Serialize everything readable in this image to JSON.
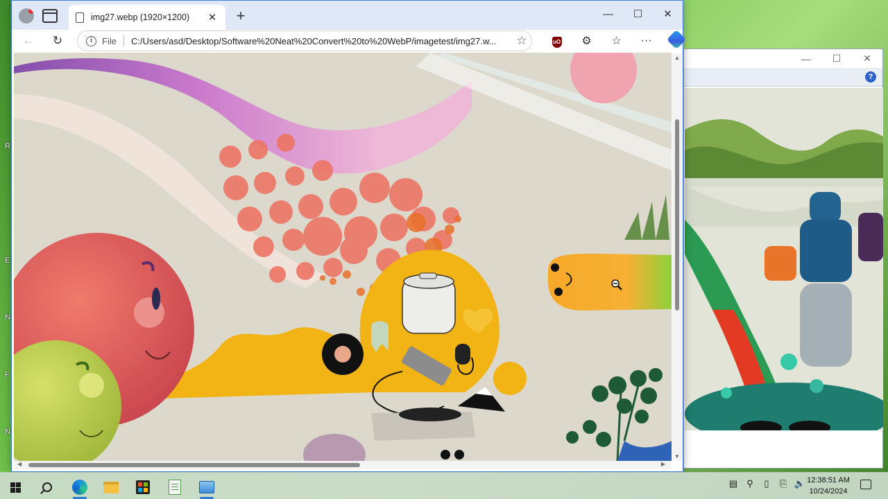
{
  "desktop": {
    "edge_letters": [
      "R",
      "E",
      "N",
      "F",
      "N"
    ]
  },
  "browser": {
    "tab": {
      "title": "img27.webp (1920×1200)"
    },
    "address": {
      "scheme_label": "File",
      "url": "C:/Users/asd/Desktop/Software%20Neat%20Convert%20to%20WebP/imagetest/img27.w..."
    },
    "nav": {
      "back_icon": "←",
      "reload_icon": "↻"
    },
    "window_caps": {
      "minimize": "—",
      "maximize": "☐",
      "close": "✕"
    },
    "new_tab_icon": "+",
    "tab_close_icon": "✕",
    "toolbar": {
      "ublock_label": "uO",
      "extensions_icon": "⚙",
      "favorites_icon": "☆",
      "more_icon": "···"
    }
  },
  "viewer_window": {
    "caps": {
      "minimize": "—",
      "maximize": "☐",
      "close": "✕"
    },
    "help_label": "?"
  },
  "taskbar": {
    "tray_icons": [
      "▤",
      "⚲",
      "▯",
      "⎘",
      "🔈"
    ],
    "clock_time": "12:38:51 AM",
    "clock_date": "10/24/2024"
  },
  "colors": {
    "accent": "#3d7fd6",
    "tabstrip": "#dfe8f7",
    "taskbar": "#cddccd"
  }
}
